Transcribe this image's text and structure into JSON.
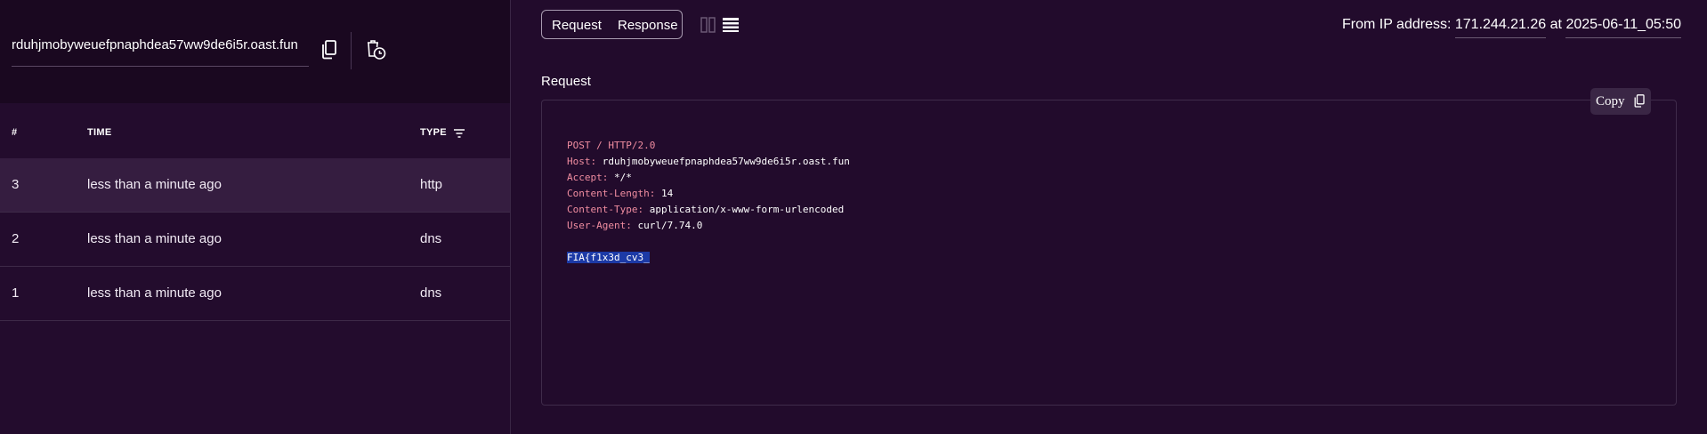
{
  "sidebar": {
    "url": "rduhjmobyweuefpnaphdea57ww9de6i5r.oast.fun",
    "icons": {
      "copy": "copy-icon",
      "clear": "clear-history-icon"
    },
    "columns": [
      "#",
      "TIME",
      "TYPE"
    ],
    "filter_icon": "filter-icon",
    "rows": [
      {
        "num": "3",
        "time": "less than a minute ago",
        "type": "http"
      },
      {
        "num": "2",
        "time": "less than a minute ago",
        "type": "dns"
      },
      {
        "num": "1",
        "time": "less than a minute ago",
        "type": "dns"
      }
    ]
  },
  "detail": {
    "tabs": [
      "Request",
      "Response"
    ],
    "view_icons": [
      "split-view-icon",
      "stacked-view-icon"
    ],
    "from_label": "From IP address:",
    "ip": "171.244.21.26",
    "at_label": "at",
    "timestamp": "2025-06-11_05:50",
    "section_title": "Request",
    "copy_label": "Copy",
    "request": {
      "line": "POST / HTTP/2.0",
      "headers": [
        {
          "key": "Host:",
          "value": "rduhjmobyweuefpnaphdea57ww9de6i5r.oast.fun"
        },
        {
          "key": "Accept:",
          "value": "*/*"
        },
        {
          "key": "Content-Length:",
          "value": "14"
        },
        {
          "key": "Content-Type:",
          "value": "application/x-www-form-urlencoded"
        },
        {
          "key": "User-Agent:",
          "value": "curl/7.74.0"
        }
      ],
      "body": "FIA{f1x3d_cv3_"
    }
  },
  "colors": {
    "background": "#220b2c",
    "selection": "#1c3aa6",
    "header_key": "#f08da0"
  }
}
